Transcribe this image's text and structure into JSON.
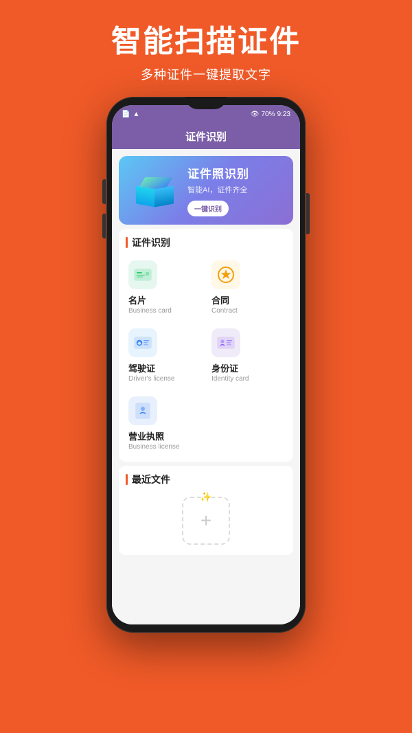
{
  "page": {
    "background_color": "#F05A28",
    "main_title": "智能扫描证件",
    "sub_title": "多种证件一键提取文字"
  },
  "phone": {
    "status_bar": {
      "time": "9:23",
      "battery": "70%",
      "wifi": "wifi",
      "signal": "signal"
    },
    "app_bar": {
      "title": "证件识别"
    },
    "banner": {
      "main_text": "证件照识别",
      "sub_text": "智能AI，证件齐全",
      "btn_label": "一键识别"
    },
    "section_id_label": "证件识别",
    "grid_items": [
      {
        "name": "名片",
        "sub": "Business card",
        "icon": "🪪",
        "color": "green"
      },
      {
        "name": "合同",
        "sub": "Contract",
        "icon": "⭐",
        "color": "yellow"
      },
      {
        "name": "驾驶证",
        "sub": "Driver's license",
        "icon": "🚗",
        "color": "blue"
      },
      {
        "name": "身份证",
        "sub": "Identity card",
        "icon": "👤",
        "color": "purple"
      },
      {
        "name": "营业执照",
        "sub": "Business license",
        "icon": "👤",
        "color": "blue2"
      }
    ],
    "recent_label": "最近文件"
  }
}
